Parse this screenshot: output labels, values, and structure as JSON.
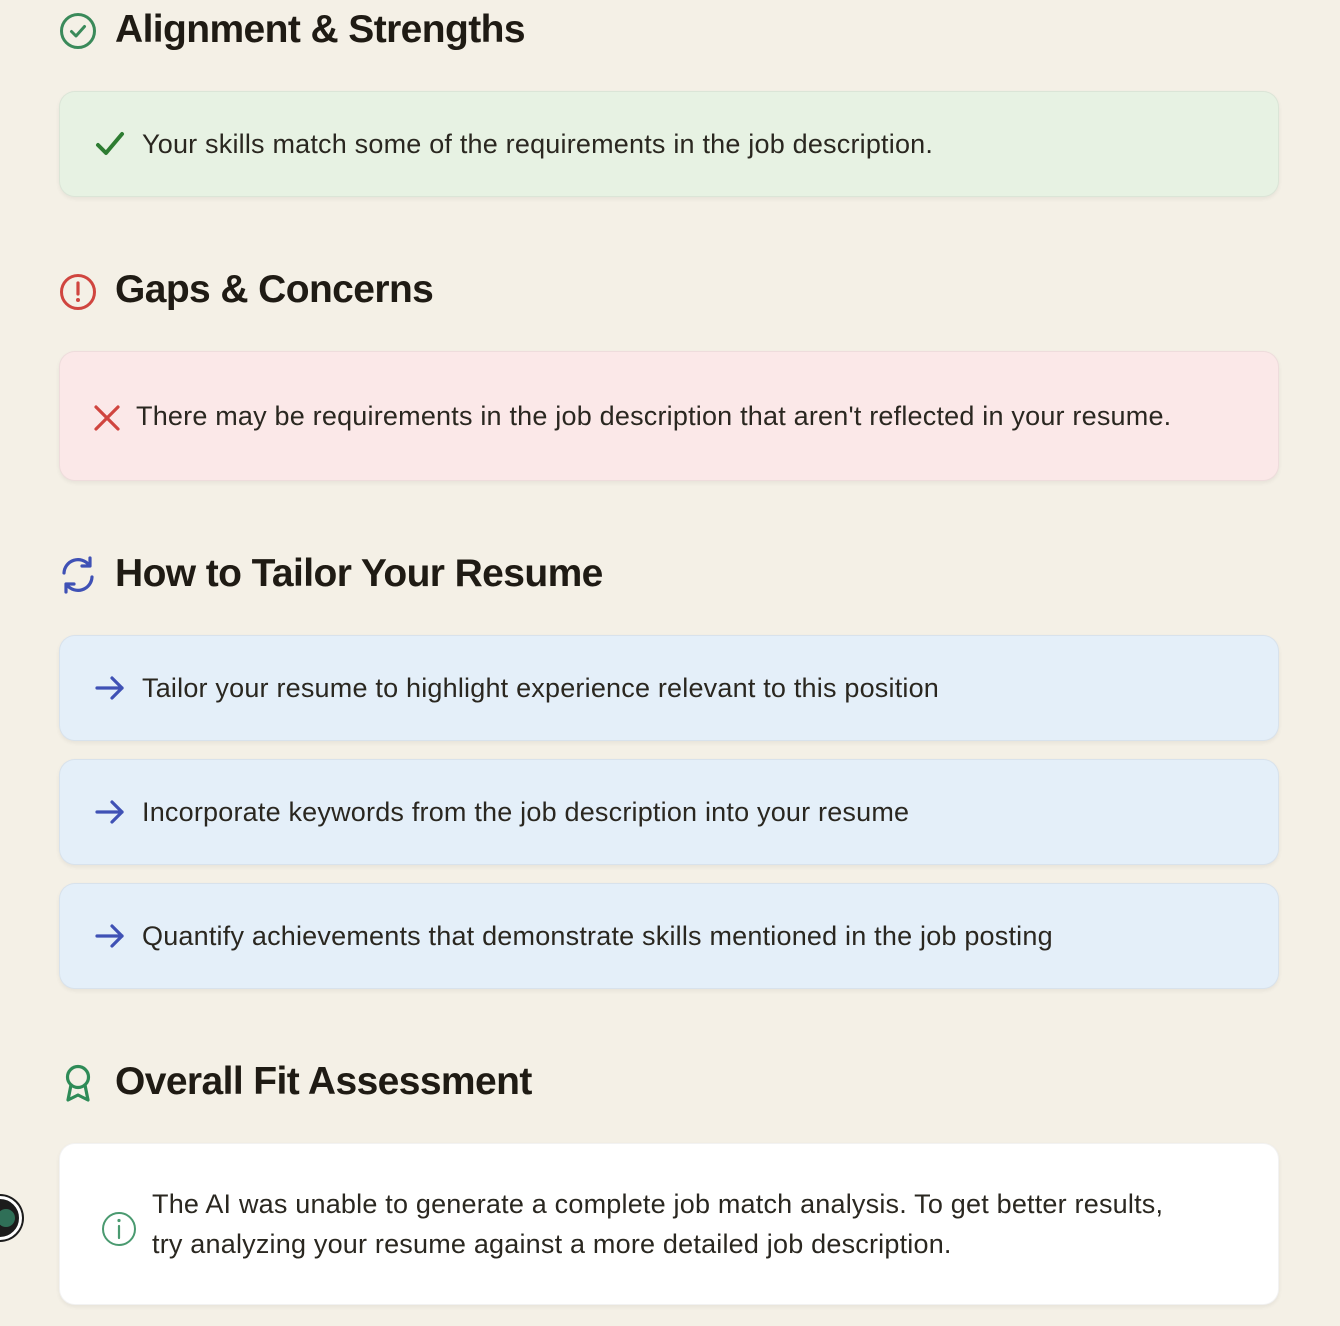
{
  "sections": {
    "strengths": {
      "title": "Alignment & Strengths",
      "icon": "check-circle-icon",
      "color": "#3a8a5a",
      "items": [
        {
          "text": "Your skills match some of the requirements in the job description.",
          "icon": "checkmark-icon",
          "icon_color": "#2e7d32"
        }
      ]
    },
    "gaps": {
      "title": "Gaps & Concerns",
      "icon": "alert-circle-icon",
      "color": "#d0453f",
      "items": [
        {
          "text": "There may be requirements in the job description that aren't reflected in your resume.",
          "icon": "x-icon",
          "icon_color": "#d0453f"
        }
      ]
    },
    "tailor": {
      "title": "How to Tailor Your Resume",
      "icon": "refresh-icon",
      "color": "#3f51b5",
      "items": [
        {
          "text": "Tailor your resume to highlight experience relevant to this position",
          "icon": "arrow-right-icon"
        },
        {
          "text": "Incorporate keywords from the job description into your resume",
          "icon": "arrow-right-icon"
        },
        {
          "text": "Quantify achievements that demonstrate skills mentioned in the job posting",
          "icon": "arrow-right-icon"
        }
      ]
    },
    "overall": {
      "title": "Overall Fit Assessment",
      "icon": "award-ribbon-icon",
      "color": "#2e8b57",
      "text": "The AI was unable to generate a complete job match analysis. To get better results, try analyzing your resume against a more detailed job description.",
      "info_icon": "info-circle-icon"
    }
  },
  "colors": {
    "page_background": "#f4f0e6",
    "strength_card": "#e7f2e3",
    "gap_card": "#fbe8e8",
    "tailor_card": "#e4eff9",
    "overall_card": "#ffffff"
  }
}
